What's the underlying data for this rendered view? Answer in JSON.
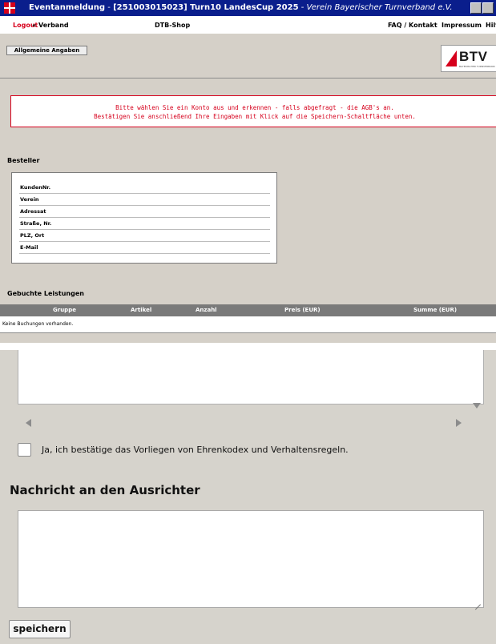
{
  "window": {
    "title_app": "Eventanmeldung",
    "title_sep": " - ",
    "title_event": "[251003015023] Turn10 LandesCup 2025",
    "title_org": "Verein Bayerischer Turnverband e.V."
  },
  "menu": {
    "logout": "Logout",
    "verband": "« Verband",
    "shop": "DTB-Shop",
    "faq": "FAQ / Kontakt",
    "impressum": "Impressum",
    "hilfe": "Hilfe"
  },
  "tab": {
    "label": "Allgemeine Angaben"
  },
  "logo": {
    "letters": "BTV",
    "subtitle": "BAYERISCHER TURNVERBAND"
  },
  "alert": {
    "line1": "Bitte wählen Sie ein Konto aus und erkennen - falls abgefragt - die AGB's an.",
    "line2": "Bestätigen Sie anschließend Ihre Eingaben mit Klick auf die Speichern-Schaltfläche unten."
  },
  "orderer": {
    "heading": "Besteller",
    "fields": [
      "KundenNr.",
      "Verein",
      "Adressat",
      "Straße, Nr.",
      "PLZ, Ort",
      "E-Mail"
    ]
  },
  "services": {
    "heading": "Gebuchte Leistungen",
    "columns": [
      "Gruppe",
      "Artikel",
      "Anzahl",
      "Preis (EUR)",
      "Summe (EUR)"
    ],
    "empty": "Keine Buchungen vorhanden."
  },
  "confirm": {
    "label": "Ja, ich bestätige das Vorliegen von Ehrenkodex und Verhaltensregeln."
  },
  "message": {
    "heading": "Nachricht an den Ausrichter",
    "value": ""
  },
  "save": {
    "label": "speichern"
  },
  "colors": {
    "titlebar": "#0a1e8c",
    "accent_red": "#d6001c",
    "panel": "#d5d0c8"
  }
}
